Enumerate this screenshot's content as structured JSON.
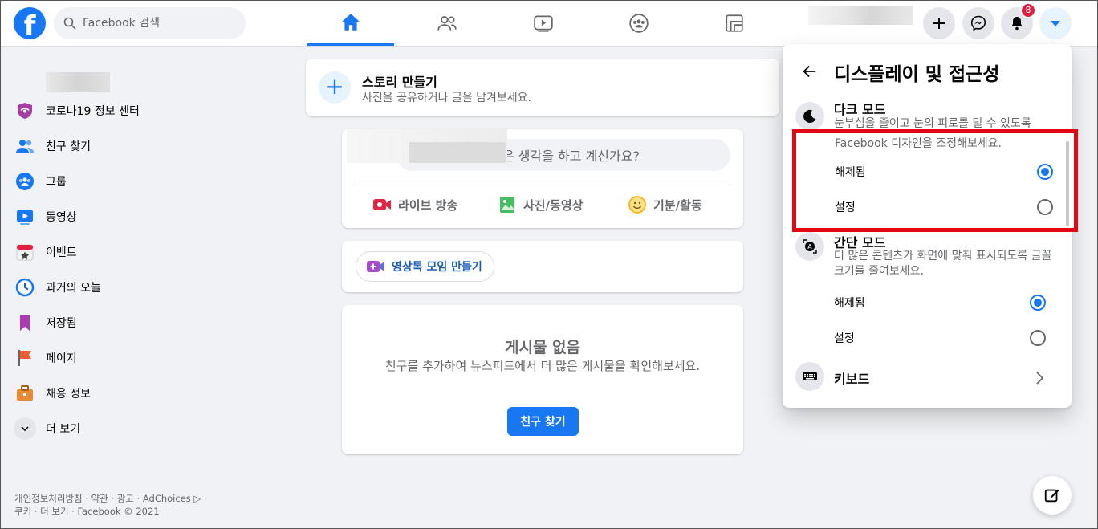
{
  "header": {
    "logo_letter": "f",
    "search_placeholder": "Facebook 검색",
    "notification_count": "8",
    "nav_tabs": [
      "home-icon",
      "friends-icon",
      "watch-icon",
      "groups-icon",
      "gaming-icon"
    ],
    "action_icons": [
      "plus-icon",
      "messenger-icon",
      "bell-icon",
      "caret-down-icon"
    ]
  },
  "sidebar": {
    "items": [
      {
        "label": "코로나19 정보 센터",
        "icon": "covid-shield-icon"
      },
      {
        "label": "친구 찾기",
        "icon": "friends-icon"
      },
      {
        "label": "그룹",
        "icon": "groups-icon"
      },
      {
        "label": "동영상",
        "icon": "watch-icon"
      },
      {
        "label": "이벤트",
        "icon": "calendar-icon"
      },
      {
        "label": "과거의 오늘",
        "icon": "clock-icon"
      },
      {
        "label": "저장됨",
        "icon": "bookmark-icon"
      },
      {
        "label": "페이지",
        "icon": "flag-icon"
      },
      {
        "label": "채용 정보",
        "icon": "briefcase-icon"
      },
      {
        "label": "더 보기",
        "icon": "chevron-down-icon"
      }
    ],
    "footer_line1": "개인정보처리방침 · 약관 · 광고 · AdChoices ▷ ·",
    "footer_line2": "쿠키 · 더 보기 · Facebook © 2021"
  },
  "feed": {
    "story_title": "스토리 만들기",
    "story_sub": "사진을 공유하거나 글을 남겨보세요.",
    "composer_placeholder": "은 생각을 하고 계신가요?",
    "composer_actions": [
      "라이브 방송",
      "사진/동영상",
      "기분/활동"
    ],
    "room_button": "영상톡 모임 만들기",
    "empty_title": "게시물 없음",
    "empty_sub": "친구를 추가하여 뉴스피드에서 더 많은 게시물을 확인해보세요.",
    "empty_button": "친구 찾기"
  },
  "panel": {
    "title": "디스플레이 및 접근성",
    "dark_mode": {
      "title": "다크 모드",
      "desc": "눈부심을 줄이고 눈의 피로를 덜 수 있도록",
      "desc_cont": "Facebook 디자인을 조정해보세요.",
      "options": [
        {
          "label": "해제됨",
          "selected": true
        },
        {
          "label": "설정",
          "selected": false
        }
      ]
    },
    "compact_mode": {
      "title": "간단 모드",
      "desc": "더 많은 콘텐츠가 화면에 맞춰 표시되도록 글꼴 크기를 줄여보세요.",
      "options": [
        {
          "label": "해제됨",
          "selected": true
        },
        {
          "label": "설정",
          "selected": false
        }
      ]
    },
    "keyboard": "키보드"
  },
  "colors": {
    "brand": "#1877f2",
    "highlight": "#e30613",
    "badge": "#e41e3f"
  }
}
